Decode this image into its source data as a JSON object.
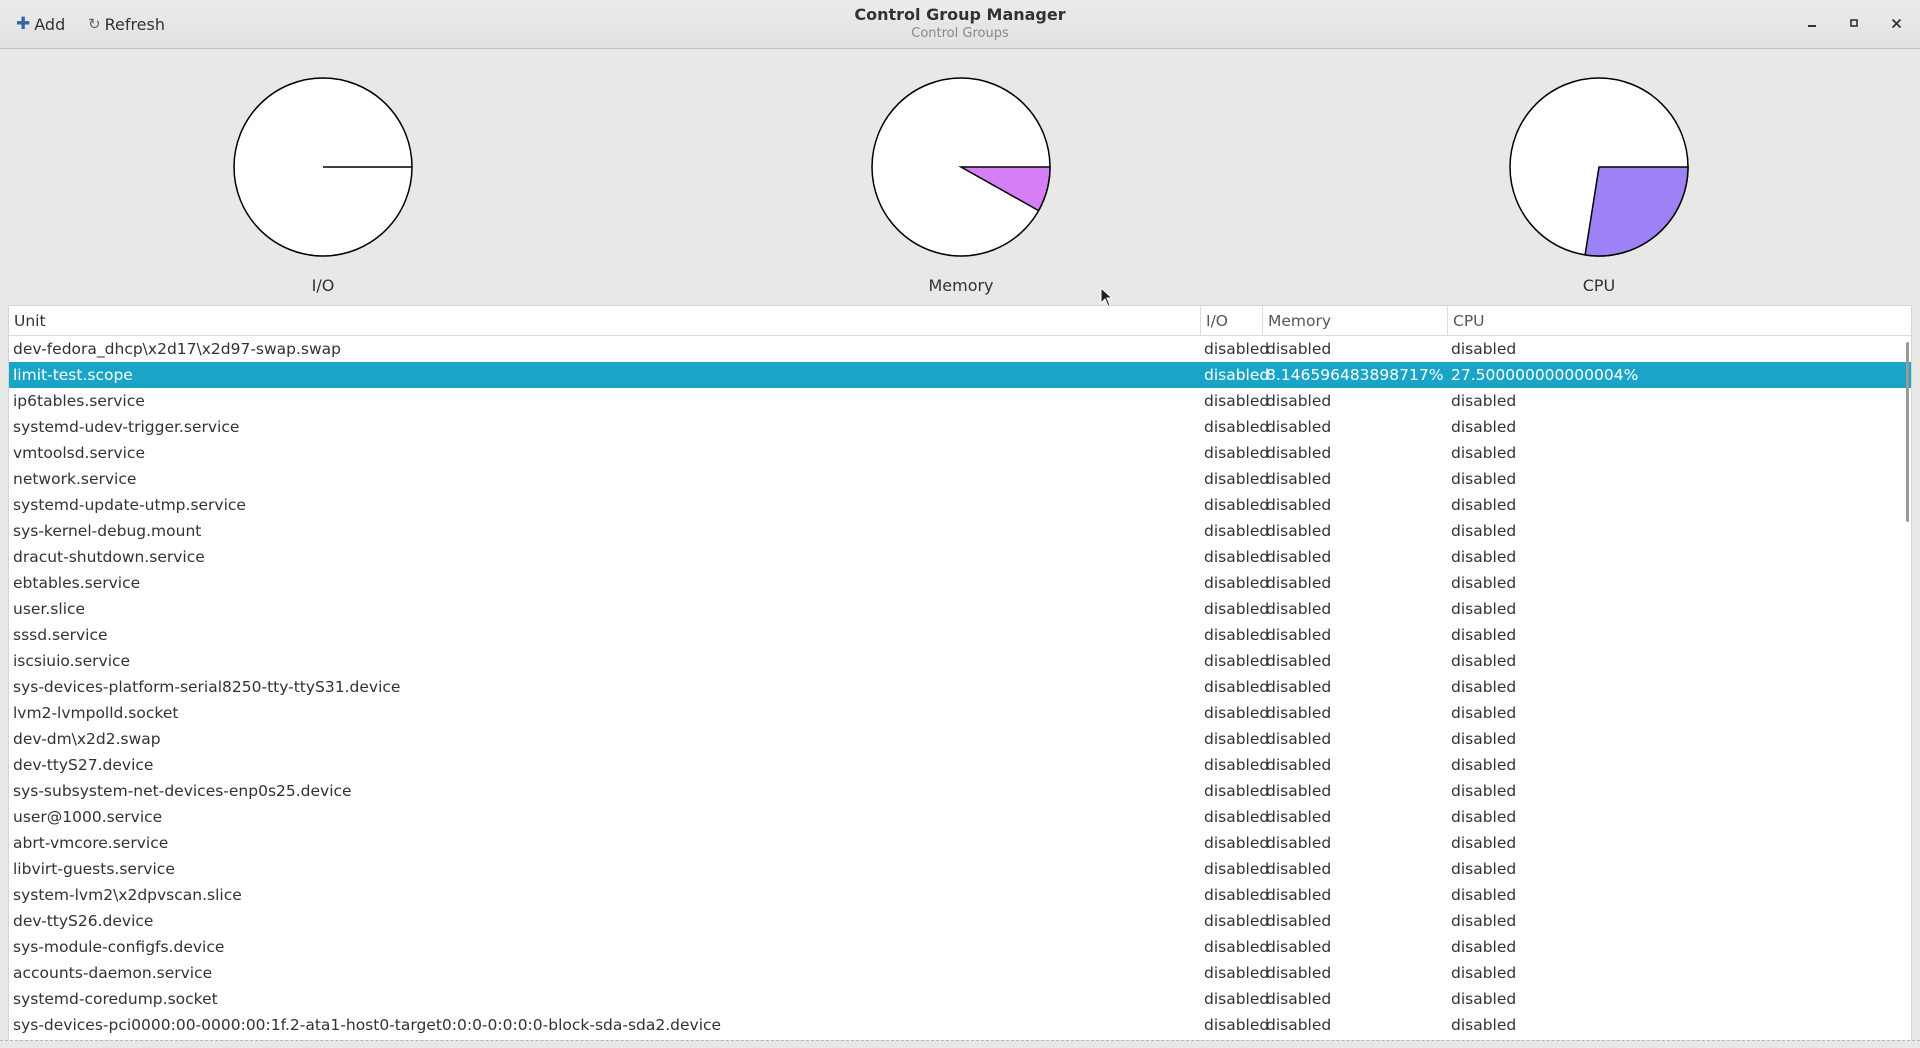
{
  "header": {
    "add_label": "Add",
    "refresh_label": "Refresh",
    "title": "Control Group Manager",
    "subtitle": "Control Groups",
    "icons": {
      "add": "plus-icon",
      "refresh": "refresh-icon",
      "minimize": "minimize-icon",
      "maximize": "maximize-icon",
      "close": "close-icon"
    }
  },
  "graphs": [
    {
      "label": "I/O",
      "fraction": 0.0,
      "color": "#ffffff"
    },
    {
      "label": "Memory",
      "fraction": 0.0815,
      "color": "#d57ef6"
    },
    {
      "label": "CPU",
      "fraction": 0.275,
      "color": "#9d82f6"
    }
  ],
  "table": {
    "columns": {
      "unit": "Unit",
      "io": "I/O",
      "memory": "Memory",
      "cpu": "CPU"
    },
    "selected_color": "#1aa5c8",
    "rows": [
      {
        "unit": "dev-fedora_dhcp\\x2d17\\x2d97-swap.swap",
        "io": "disabled",
        "memory": "disabled",
        "cpu": "disabled"
      },
      {
        "unit": "limit-test.scope",
        "io": "disabled",
        "memory": "8.146596483898717%",
        "cpu": "27.500000000000004%",
        "selected": true
      },
      {
        "unit": "ip6tables.service",
        "io": "disabled",
        "memory": "disabled",
        "cpu": "disabled"
      },
      {
        "unit": "systemd-udev-trigger.service",
        "io": "disabled",
        "memory": "disabled",
        "cpu": "disabled"
      },
      {
        "unit": "vmtoolsd.service",
        "io": "disabled",
        "memory": "disabled",
        "cpu": "disabled"
      },
      {
        "unit": "network.service",
        "io": "disabled",
        "memory": "disabled",
        "cpu": "disabled"
      },
      {
        "unit": "systemd-update-utmp.service",
        "io": "disabled",
        "memory": "disabled",
        "cpu": "disabled"
      },
      {
        "unit": "sys-kernel-debug.mount",
        "io": "disabled",
        "memory": "disabled",
        "cpu": "disabled"
      },
      {
        "unit": "dracut-shutdown.service",
        "io": "disabled",
        "memory": "disabled",
        "cpu": "disabled"
      },
      {
        "unit": "ebtables.service",
        "io": "disabled",
        "memory": "disabled",
        "cpu": "disabled"
      },
      {
        "unit": "user.slice",
        "io": "disabled",
        "memory": "disabled",
        "cpu": "disabled"
      },
      {
        "unit": "sssd.service",
        "io": "disabled",
        "memory": "disabled",
        "cpu": "disabled"
      },
      {
        "unit": "iscsiuio.service",
        "io": "disabled",
        "memory": "disabled",
        "cpu": "disabled"
      },
      {
        "unit": "sys-devices-platform-serial8250-tty-ttyS31.device",
        "io": "disabled",
        "memory": "disabled",
        "cpu": "disabled"
      },
      {
        "unit": "lvm2-lvmpolld.socket",
        "io": "disabled",
        "memory": "disabled",
        "cpu": "disabled"
      },
      {
        "unit": "dev-dm\\x2d2.swap",
        "io": "disabled",
        "memory": "disabled",
        "cpu": "disabled"
      },
      {
        "unit": "dev-ttyS27.device",
        "io": "disabled",
        "memory": "disabled",
        "cpu": "disabled"
      },
      {
        "unit": "sys-subsystem-net-devices-enp0s25.device",
        "io": "disabled",
        "memory": "disabled",
        "cpu": "disabled"
      },
      {
        "unit": "user@1000.service",
        "io": "disabled",
        "memory": "disabled",
        "cpu": "disabled"
      },
      {
        "unit": "abrt-vmcore.service",
        "io": "disabled",
        "memory": "disabled",
        "cpu": "disabled"
      },
      {
        "unit": "libvirt-guests.service",
        "io": "disabled",
        "memory": "disabled",
        "cpu": "disabled"
      },
      {
        "unit": "system-lvm2\\x2dpvscan.slice",
        "io": "disabled",
        "memory": "disabled",
        "cpu": "disabled"
      },
      {
        "unit": "dev-ttyS26.device",
        "io": "disabled",
        "memory": "disabled",
        "cpu": "disabled"
      },
      {
        "unit": "sys-module-configfs.device",
        "io": "disabled",
        "memory": "disabled",
        "cpu": "disabled"
      },
      {
        "unit": "accounts-daemon.service",
        "io": "disabled",
        "memory": "disabled",
        "cpu": "disabled"
      },
      {
        "unit": "systemd-coredump.socket",
        "io": "disabled",
        "memory": "disabled",
        "cpu": "disabled"
      },
      {
        "unit": "sys-devices-pci0000:00-0000:00:1f.2-ata1-host0-target0:0:0-0:0:0:0-block-sda-sda2.device",
        "io": "disabled",
        "memory": "disabled",
        "cpu": "disabled"
      }
    ]
  }
}
